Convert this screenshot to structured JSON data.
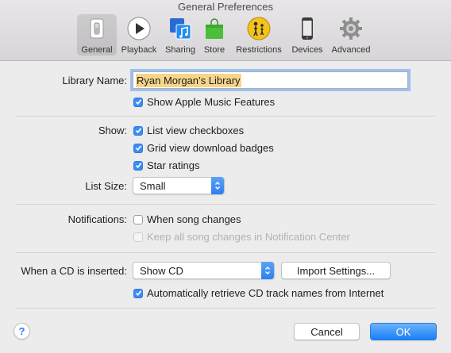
{
  "window": {
    "title": "General Preferences"
  },
  "toolbar": {
    "items": [
      {
        "label": "General",
        "icon": "general-switch-icon",
        "selected": true
      },
      {
        "label": "Playback",
        "icon": "play-icon"
      },
      {
        "label": "Sharing",
        "icon": "music-sharing-icon"
      },
      {
        "label": "Store",
        "icon": "shopping-bag-icon"
      },
      {
        "label": "Restrictions",
        "icon": "parental-restrictions-icon"
      },
      {
        "label": "Devices",
        "icon": "iphone-icon"
      },
      {
        "label": "Advanced",
        "icon": "gear-icon"
      }
    ]
  },
  "library": {
    "label": "Library Name:",
    "value": "Ryan Morgan’s Library",
    "show_apple_music": {
      "label": "Show Apple Music Features",
      "checked": true
    }
  },
  "show": {
    "label": "Show:",
    "options": [
      {
        "label": "List view checkboxes",
        "checked": true
      },
      {
        "label": "Grid view download badges",
        "checked": true
      },
      {
        "label": "Star ratings",
        "checked": true
      }
    ],
    "list_size_label": "List Size:",
    "list_size_value": "Small"
  },
  "notifications": {
    "label": "Notifications:",
    "when_song_changes": {
      "label": "When song changes",
      "checked": false
    },
    "keep_all": {
      "label": "Keep all song changes in Notification Center",
      "checked": false,
      "disabled": true
    }
  },
  "cd": {
    "label": "When a CD is inserted:",
    "action_value": "Show CD",
    "import_button": "Import Settings...",
    "auto_retrieve": {
      "label": "Automatically retrieve CD track names from Internet",
      "checked": true
    }
  },
  "footer": {
    "help": "?",
    "cancel": "Cancel",
    "ok": "OK"
  },
  "colors": {
    "accent": "#3b8cf7",
    "selection_highlight": "#f7d589",
    "focus_ring": "#9cc1f2"
  }
}
